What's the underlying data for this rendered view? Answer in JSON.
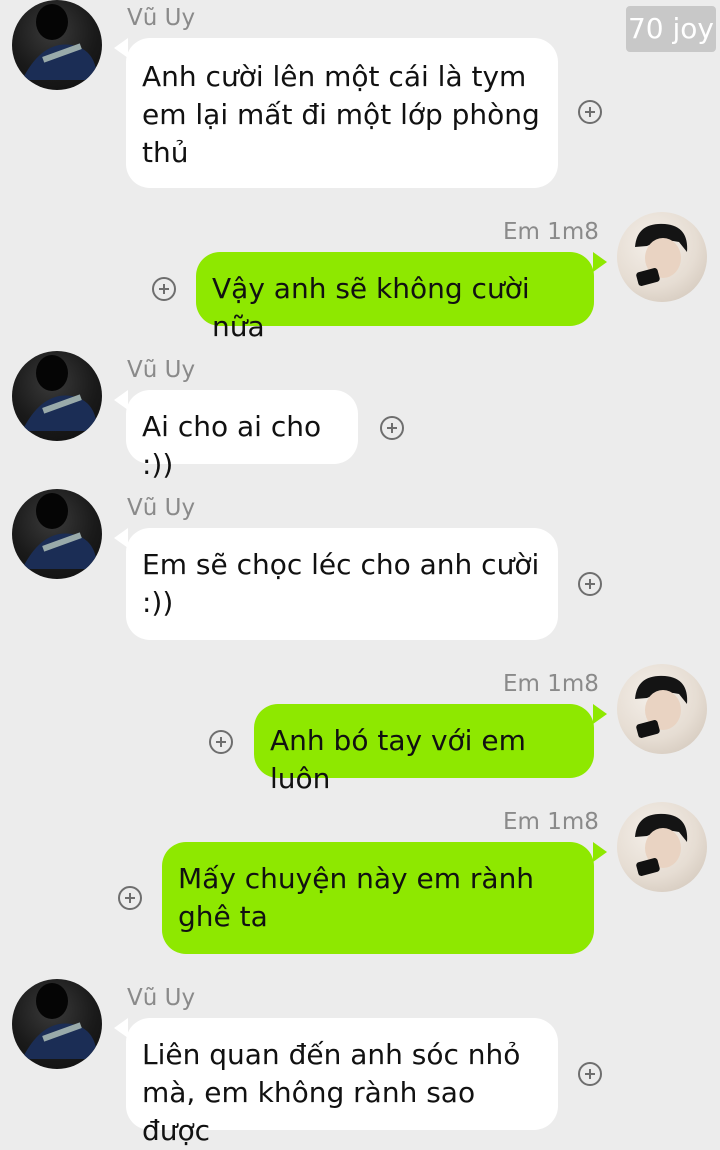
{
  "badge": "70 joy",
  "messages": [
    {
      "sender": "Vũ Uy",
      "side": "left",
      "text": "Anh cười lên một cái là tym em lại mất đi một lớp phòng thủ"
    },
    {
      "sender": "Em 1m8",
      "side": "right",
      "text": "Vậy anh sẽ không cười nữa"
    },
    {
      "sender": "Vũ Uy",
      "side": "left",
      "text": "Ai cho ai cho :))"
    },
    {
      "sender": "Vũ Uy",
      "side": "left",
      "text": "Em sẽ chọc léc cho anh cười :))"
    },
    {
      "sender": "Em 1m8",
      "side": "right",
      "text": "Anh bó tay với em luôn"
    },
    {
      "sender": "Em 1m8",
      "side": "right",
      "text": "Mấy chuyện này em rành ghê ta"
    },
    {
      "sender": "Vũ Uy",
      "side": "left",
      "text": "Liên quan đến anh sóc nhỏ mà, em không rành sao được"
    }
  ],
  "colors": {
    "left_bubble": "#ffffff",
    "right_bubble": "#8ee800",
    "background": "#ececec"
  }
}
